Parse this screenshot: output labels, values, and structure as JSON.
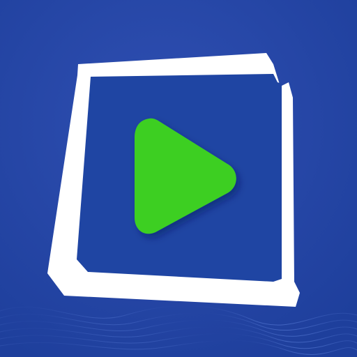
{
  "app_icon": {
    "icon_name": "video-play-icon",
    "colors": {
      "background": "#1e3f9c",
      "background_light": "#2f4fb2",
      "frame": "#ffffff",
      "inner_panel": "#1f45a3",
      "play_button": "#3ecf23",
      "wave": "#7fa5ff"
    }
  }
}
